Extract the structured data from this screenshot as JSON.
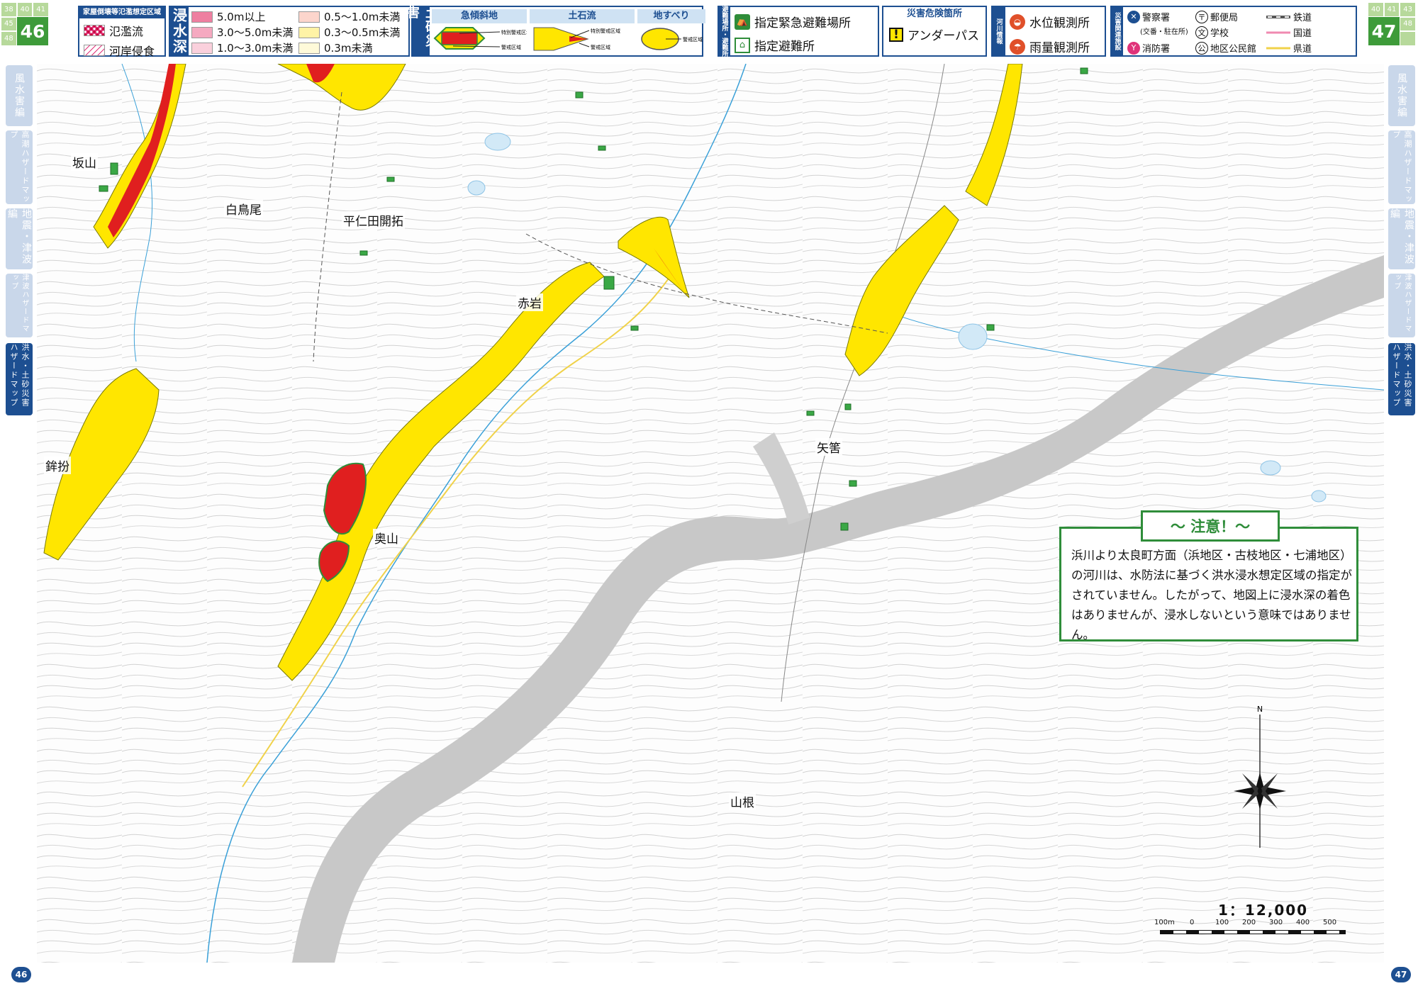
{
  "page_badges": {
    "left": {
      "number": "46",
      "mini": [
        "38",
        "40",
        "41",
        "45",
        "47",
        "48"
      ]
    },
    "right": {
      "number": "47",
      "mini": [
        "40",
        "41",
        "43",
        "46",
        "48"
      ]
    }
  },
  "legend": {
    "house_collapse": {
      "title": "家屋倒壊等氾濫想定区域",
      "items": [
        {
          "label": "氾濫流",
          "color": "#e0337a"
        },
        {
          "label": "河岸侵食",
          "color": "#e0337a"
        }
      ]
    },
    "inundation": {
      "heading": "浸水深",
      "items": [
        {
          "label": "5.0m以上",
          "color": "#ee7fa0"
        },
        {
          "label": "0.5～1.0m未満",
          "color": "#fcd5cc"
        },
        {
          "label": "3.0～5.0m未満",
          "color": "#f5a9c0"
        },
        {
          "label": "0.3～0.5m未満",
          "color": "#fff3a6"
        },
        {
          "label": "1.0～3.0m未満",
          "color": "#fad0dc"
        },
        {
          "label": "0.3m未満",
          "color": "#fffad9"
        }
      ]
    },
    "sediment": {
      "heading": "土砂災害",
      "columns": [
        {
          "label": "急傾斜地",
          "sub": [
            "特別警戒区域",
            "警戒区域"
          ]
        },
        {
          "label": "土石流",
          "sub": [
            "特別警戒区域",
            "警戒区域"
          ]
        },
        {
          "label": "地すべり",
          "sub": [
            "警戒区域"
          ]
        }
      ]
    },
    "evacuation": {
      "heading": "避難場所・避難所",
      "items": [
        {
          "label": "指定緊急避難場所",
          "icon": "emergency-evacuation-site-icon"
        },
        {
          "label": "指定避難所",
          "icon": "designated-shelter-icon"
        }
      ]
    },
    "danger": {
      "heading": "災害危険箇所",
      "items": [
        {
          "label": "アンダーパス",
          "icon": "underpass-warning-icon"
        }
      ]
    },
    "river": {
      "heading": "河川情報",
      "items": [
        {
          "label": "水位観測所",
          "icon": "water-level-station-icon"
        },
        {
          "label": "雨量観測所",
          "icon": "rain-gauge-station-icon"
        }
      ]
    },
    "facilities": {
      "heading": "災害関連施設",
      "items": [
        {
          "label": "警察署",
          "note": "(交番・駐在所)",
          "icon": "police-icon"
        },
        {
          "label": "郵便局",
          "icon": "post-office-icon"
        },
        {
          "label": "消防署",
          "icon": "fire-station-icon"
        },
        {
          "label": "学校",
          "icon": "school-icon"
        },
        {
          "label": "地区公民館",
          "icon": "community-hall-icon"
        }
      ],
      "lines": [
        {
          "label": "鉄道",
          "color": "#555555"
        },
        {
          "label": "国道",
          "color": "#f08ab0"
        },
        {
          "label": "県道",
          "color": "#f0d24a"
        }
      ]
    }
  },
  "side_tabs_left": [
    {
      "label": "風水害編",
      "active": false
    },
    {
      "label": "高潮ハザードマップ",
      "active": false
    },
    {
      "label": "地震・津波編",
      "active": false
    },
    {
      "label": "津波ハザードマップ",
      "active": false
    },
    {
      "label": "洪水・土砂災害ハザードマップ",
      "active": true
    }
  ],
  "side_tabs_right": [
    {
      "label": "風水害編",
      "active": false
    },
    {
      "label": "高潮ハザードマップ",
      "active": false
    },
    {
      "label": "地震・津波編",
      "active": false
    },
    {
      "label": "津波ハザードマップ",
      "active": false
    },
    {
      "label": "洪水・土砂災害ハザードマップ",
      "active": true
    }
  ],
  "place_names": [
    "坂山",
    "白鳥尾",
    "平仁田開拓",
    "赤岩",
    "鉾扮",
    "奥山",
    "矢筈",
    "山根"
  ],
  "notice": {
    "title": "～ 注意！～",
    "body": "浜川より太良町方面（浜地区・古枝地区・七浦地区）の河川は、水防法に基づく洪水浸水想定区域の指定がされていません。したがって、地図上に浸水深の着色はありませんが、浸水しないという意味ではありません。"
  },
  "scale": {
    "ratio": "1：12,000",
    "ticks": [
      "100m",
      "0",
      "100",
      "200",
      "300",
      "400",
      "500"
    ]
  },
  "north_label": "N",
  "page_numbers": {
    "left": "46",
    "right": "47"
  },
  "colors": {
    "brand_blue": "#1d4f91",
    "hazard_red": "#e01f1f",
    "hazard_yellow": "#ffe600",
    "evac_green": "#2f8d3a",
    "highway_gray": "#c8c8c8"
  }
}
